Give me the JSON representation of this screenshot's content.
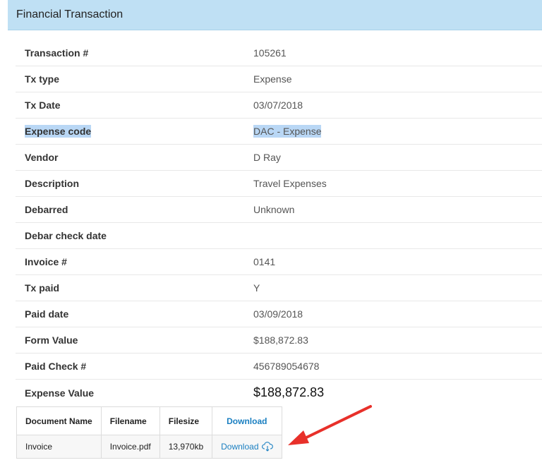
{
  "panel": {
    "title": "Financial Transaction"
  },
  "details": [
    {
      "label": "Transaction #",
      "value": "105261"
    },
    {
      "label": "Tx type",
      "value": "Expense"
    },
    {
      "label": "Tx Date",
      "value": "03/07/2018"
    },
    {
      "label": "Expense code",
      "value": "DAC - Expense"
    },
    {
      "label": "Vendor",
      "value": "D Ray"
    },
    {
      "label": "Description",
      "value": "Travel Expenses"
    },
    {
      "label": "Debarred",
      "value": "Unknown"
    },
    {
      "label": "Debar check date",
      "value": ""
    },
    {
      "label": "Invoice #",
      "value": "0141"
    },
    {
      "label": "Tx paid",
      "value": "Y"
    },
    {
      "label": "Paid date",
      "value": "03/09/2018"
    },
    {
      "label": "Form Value",
      "value": "$188,872.83"
    },
    {
      "label": "Paid Check #",
      "value": "456789054678"
    },
    {
      "label": "Expense Value",
      "value": "$188,872.83"
    }
  ],
  "documents": {
    "headers": [
      "Document Name",
      "Filename",
      "Filesize",
      "Download"
    ],
    "rows": [
      {
        "name": "Invoice",
        "filename": "Invoice.pdf",
        "filesize": "13,970kb",
        "download": "Download"
      }
    ]
  },
  "icons": {
    "download": "cloud-download-icon",
    "annotation": "red-arrow-icon"
  },
  "colors": {
    "header_bg": "#bfe0f4",
    "link": "#1a7fc1",
    "highlight": "#b9d7f5",
    "arrow": "#e8302a"
  }
}
